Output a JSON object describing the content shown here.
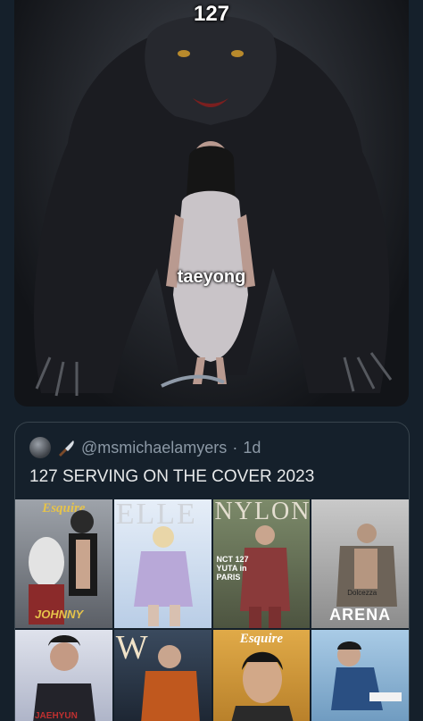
{
  "main_image": {
    "caption_top": "127",
    "caption_mid": "taeyong",
    "description_icon": "werewolf-meme-image"
  },
  "quote": {
    "avatar_icon": "avatar-icon",
    "emoji_icon": "knife-icon",
    "handle": "@msmichaelamyers",
    "separator": "·",
    "time": "1d",
    "text": "127 SERVING ON THE COVER 2023"
  },
  "covers": [
    {
      "mast": "Esquire",
      "label": "JOHNNY",
      "bg": "#8a8f96"
    },
    {
      "mast": "ELLE",
      "label": "",
      "bg": "#cfe0f2"
    },
    {
      "mast": "NYLON",
      "label": "NCT 127 YUTA in PARIS",
      "bg": "#6f7a63"
    },
    {
      "mast": "Dolcezza",
      "label": "ARENA",
      "bg": "#b8b8b8"
    },
    {
      "mast": "",
      "label": "JAEHYUN",
      "bg": "#cfd3e0"
    },
    {
      "mast": "W",
      "label": "",
      "bg": "#2c3a4c"
    },
    {
      "mast": "Esquire",
      "label": "",
      "bg": "#d09a3a"
    },
    {
      "mast": "",
      "label": "",
      "bg": "#8fb8d8"
    }
  ]
}
